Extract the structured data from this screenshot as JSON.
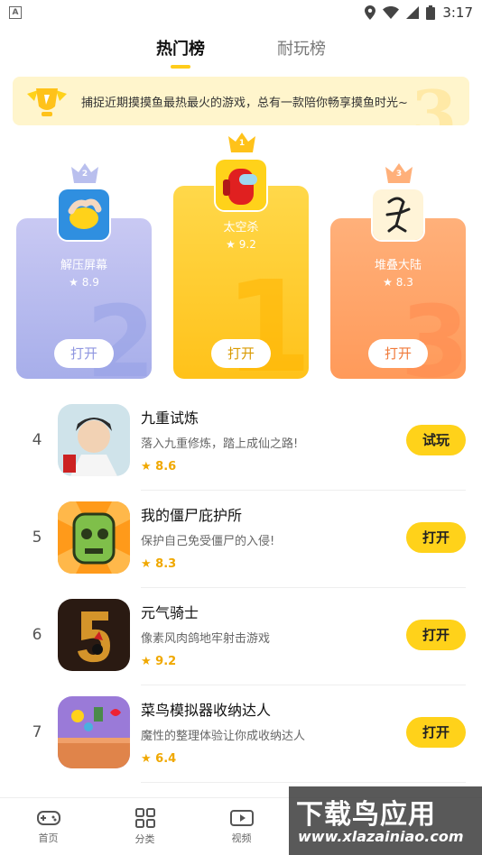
{
  "status_bar": {
    "left_icon": "A",
    "time": "3:17"
  },
  "tabs": [
    {
      "label": "热门榜",
      "active": true
    },
    {
      "label": "耐玩榜",
      "active": false
    }
  ],
  "banner": {
    "text": "捕捉近期摸摸鱼最热最火的游戏，总有一款陪你畅享摸鱼时光~"
  },
  "podium": [
    {
      "rank": "2",
      "name": "解压屏幕",
      "rating": "★ 8.9",
      "button": "打开",
      "icon": "yellow-stress-ball-icon",
      "color": "#a7aeea"
    },
    {
      "rank": "1",
      "name": "太空杀",
      "rating": "★ 9.2",
      "button": "打开",
      "icon": "red-crewmate-icon",
      "color": "#ffc21a"
    },
    {
      "rank": "3",
      "name": "堆叠大陆",
      "rating": "★ 8.3",
      "button": "打开",
      "icon": "stick-figure-icon",
      "color": "#ff9a5a"
    }
  ],
  "list": [
    {
      "rank": "4",
      "name": "九重试炼",
      "desc": "落入九重修炼，踏上成仙之路!",
      "rating": "★ 8.6",
      "button": "试玩"
    },
    {
      "rank": "5",
      "name": "我的僵尸庇护所",
      "desc": "保护自己免受僵尸的入侵!",
      "rating": "★ 8.3",
      "button": "打开"
    },
    {
      "rank": "6",
      "name": "元气骑士",
      "desc": "像素风肉鸽地牢射击游戏",
      "rating": "★ 9.2",
      "button": "打开"
    },
    {
      "rank": "7",
      "name": "菜鸟模拟器收纳达人",
      "desc": "魔性的整理体验让你成收纳达人",
      "rating": "★ 6.4",
      "button": "打开"
    }
  ],
  "bottom_nav": [
    {
      "label": "首页",
      "icon": "gamepad-icon"
    },
    {
      "label": "分类",
      "icon": "grid-icon"
    },
    {
      "label": "视频",
      "icon": "video-icon"
    }
  ],
  "watermark": {
    "title": "下载鸟应用",
    "url": "www.xlazainiao.com"
  },
  "colors": {
    "accent": "#ffd21a",
    "rating": "#f0a800"
  }
}
